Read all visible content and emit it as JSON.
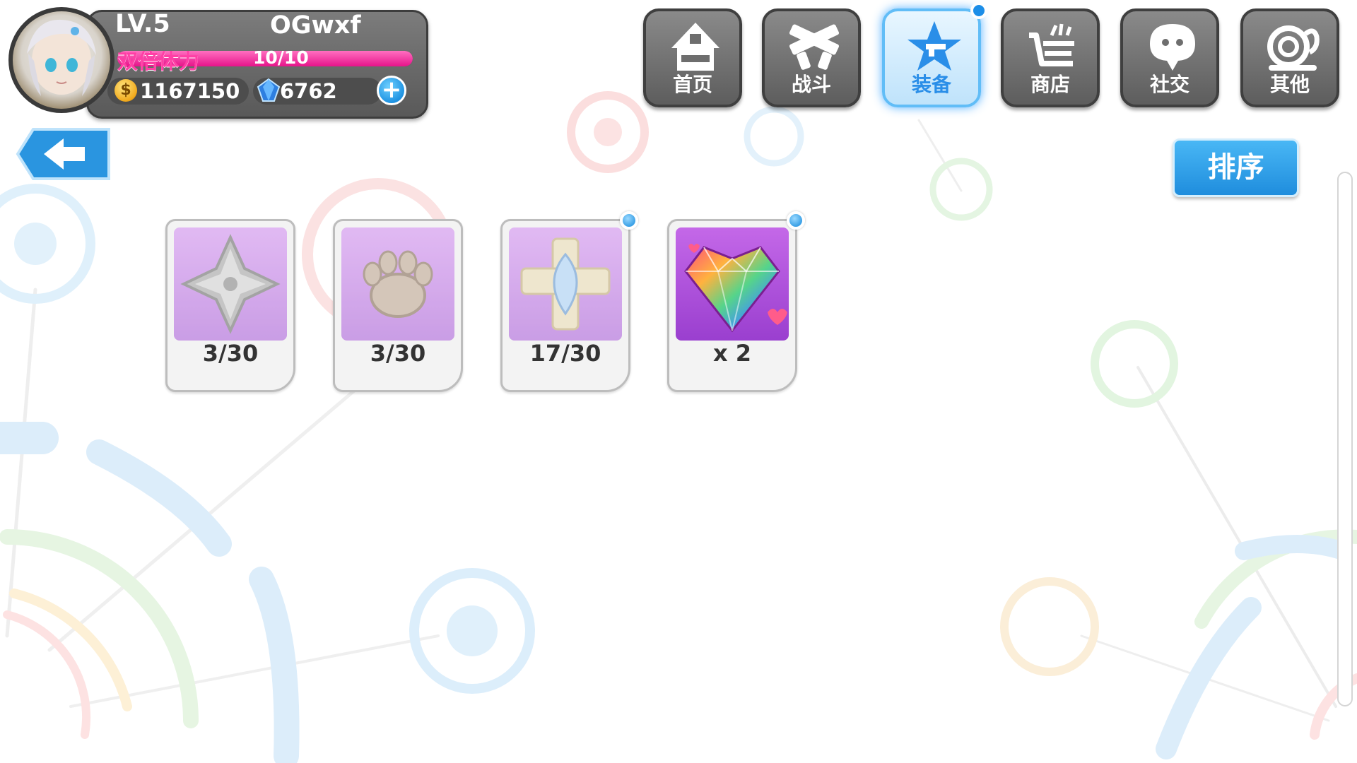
{
  "player": {
    "level": "LV.5",
    "name": "OGwxf",
    "stamina_label": "双倍体力",
    "stamina_value": "10/10",
    "stamina_fraction": 1.0,
    "gold": "1167150",
    "gems": "6762",
    "gold_icon_glyph": "$",
    "add_glyph": "+"
  },
  "nav": {
    "items": [
      {
        "label": "首页",
        "icon": "house-icon"
      },
      {
        "label": "战斗",
        "icon": "crossed-guns-icon"
      },
      {
        "label": "装备",
        "icon": "star-gun-icon",
        "active": true
      },
      {
        "label": "商店",
        "icon": "shopping-cart-icon"
      },
      {
        "label": "社交",
        "icon": "chat-bubble-icon"
      },
      {
        "label": "其他",
        "icon": "snail-icon"
      }
    ]
  },
  "toolbar": {
    "sort_label": "排序",
    "back_icon": "back-arrow-icon"
  },
  "items": [
    {
      "count": "3/30",
      "icon": "silver-cross-icon",
      "new": false
    },
    {
      "count": "3/30",
      "icon": "paw-print-icon",
      "new": false
    },
    {
      "count": "17/30",
      "icon": "crystal-cross-icon",
      "new": true
    },
    {
      "count": "x 2",
      "icon": "rainbow-heart-gem-icon",
      "new": true
    }
  ],
  "colors": {
    "accent_blue": "#2a8ee8",
    "stamina_pink": "#e6148a",
    "nav_gray": "#6e6e6e",
    "item_purple": "#c68ee6"
  }
}
